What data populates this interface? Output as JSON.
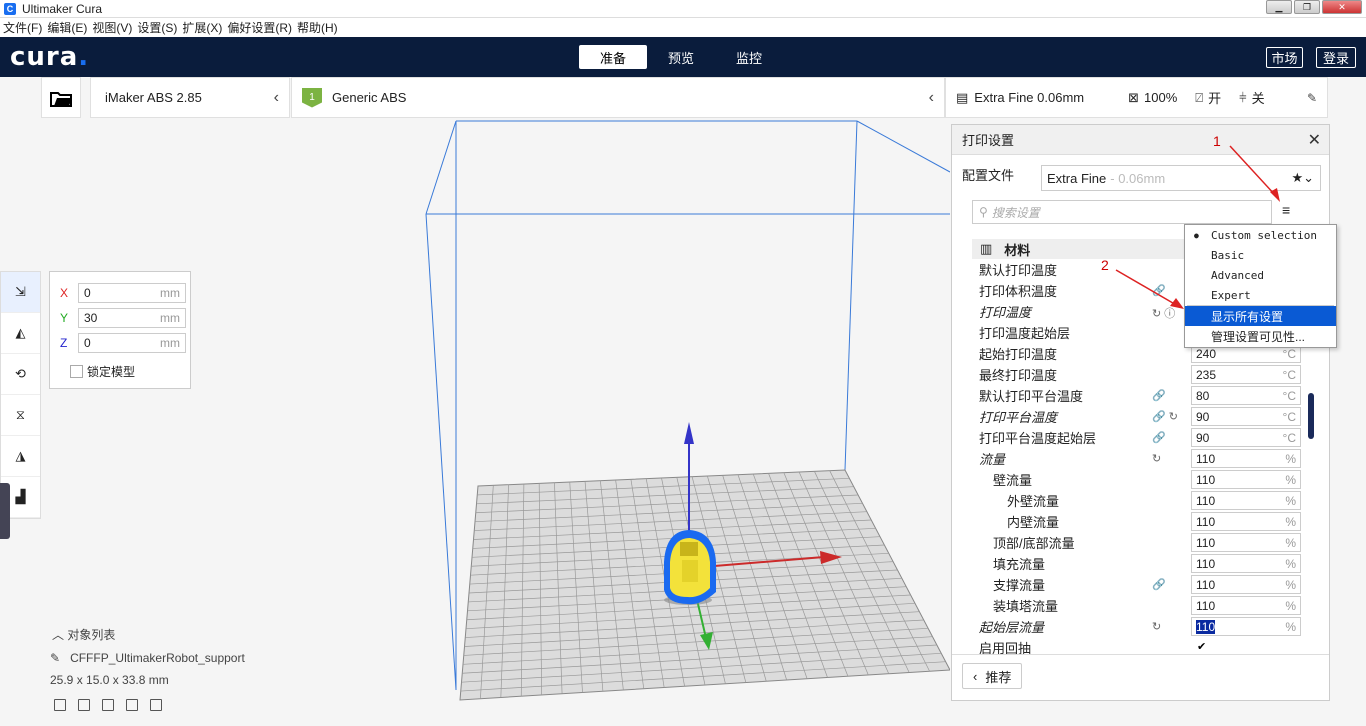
{
  "window": {
    "title": "Ultimaker Cura"
  },
  "menu": [
    "文件(F)",
    "编辑(E)",
    "视图(V)",
    "设置(S)",
    "扩展(X)",
    "偏好设置(R)",
    "帮助(H)"
  ],
  "header": {
    "tabs": [
      "准备",
      "预览",
      "监控"
    ],
    "market": "市场",
    "login": "登录"
  },
  "stage": {
    "machine": "iMaker ABS 2.85",
    "extruder_num": "1",
    "material": "Generic ABS",
    "quality": "Extra Fine 0.06mm",
    "infill": "100%",
    "support": "开",
    "adhesion": "关"
  },
  "move": {
    "x": "0",
    "y": "30",
    "z": "0",
    "unit": "mm",
    "lock": "锁定模型"
  },
  "objects": {
    "header": "对象列表",
    "name": "CFFFP_UltimakerRobot_support",
    "dims": "25.9 x 15.0 x 33.8 mm"
  },
  "panel": {
    "title": "打印设置",
    "profile_label": "配置文件",
    "profile_name": "Extra Fine",
    "profile_sub": "- 0.06mm",
    "search_placeholder": "搜索设置",
    "category": "材料",
    "recommend": "推荐",
    "settings": [
      {
        "label": "默认打印温度",
        "value": "",
        "unit": ""
      },
      {
        "label": "打印体积温度",
        "value": "",
        "unit": ""
      },
      {
        "label": "打印温度",
        "value": "",
        "unit": ""
      },
      {
        "label": "打印温度起始层",
        "value": "",
        "unit": ""
      },
      {
        "label": "起始打印温度",
        "value": "240",
        "unit": "°C"
      },
      {
        "label": "最终打印温度",
        "value": "235",
        "unit": "°C"
      },
      {
        "label": "默认打印平台温度",
        "value": "80",
        "unit": "°C"
      },
      {
        "label": "打印平台温度",
        "value": "90",
        "unit": "°C"
      },
      {
        "label": "打印平台温度起始层",
        "value": "90",
        "unit": "°C"
      },
      {
        "label": "流量",
        "value": "110",
        "unit": "%"
      },
      {
        "label": "壁流量",
        "value": "110",
        "unit": "%"
      },
      {
        "label": "外壁流量",
        "value": "110",
        "unit": "%"
      },
      {
        "label": "内壁流量",
        "value": "110",
        "unit": "%"
      },
      {
        "label": "顶部/底部流量",
        "value": "110",
        "unit": "%"
      },
      {
        "label": "填充流量",
        "value": "110",
        "unit": "%"
      },
      {
        "label": "支撑流量",
        "value": "110",
        "unit": "%"
      },
      {
        "label": "装填塔流量",
        "value": "110",
        "unit": "%"
      },
      {
        "label": "起始层流量",
        "value": "110",
        "unit": "%"
      },
      {
        "label": "启用回抽",
        "value": "",
        "unit": ""
      }
    ]
  },
  "dropdown": {
    "items": [
      "Custom selection",
      "Basic",
      "Advanced",
      "Expert"
    ],
    "show_all": "显示所有设置",
    "manage": "管理设置可见性..."
  },
  "annotations": [
    "1",
    "2"
  ]
}
